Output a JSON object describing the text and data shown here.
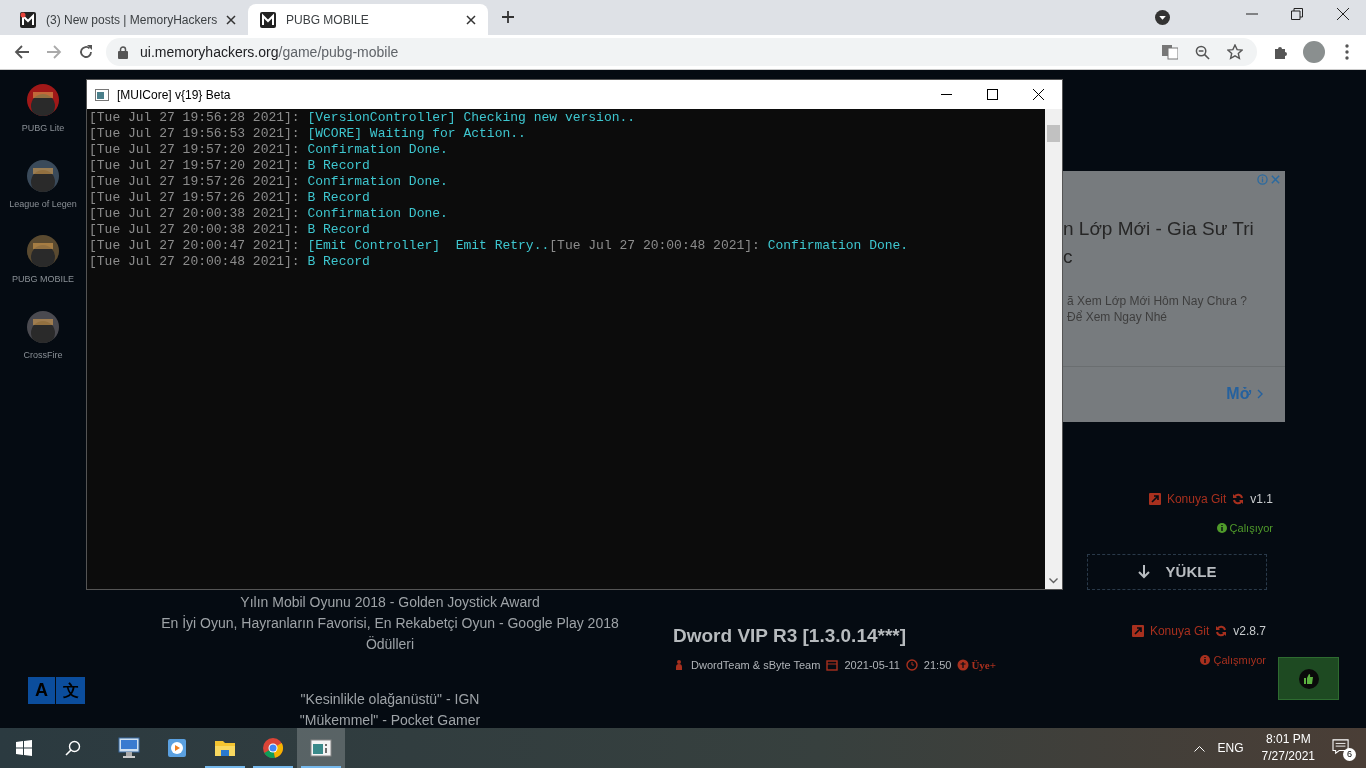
{
  "browser": {
    "tabs": [
      {
        "title": "(3) New posts | MemoryHackers",
        "selected": false,
        "notification": true
      },
      {
        "title": "PUBG MOBILE",
        "selected": true,
        "notification": false
      }
    ],
    "url": {
      "host": "ui.memoryhackers.org",
      "path": "/game/pubg-mobile"
    }
  },
  "sidebar": {
    "games": [
      {
        "label": "PUBG Lite"
      },
      {
        "label": "League of Legen"
      },
      {
        "label": "PUBG MOBILE"
      },
      {
        "label": "CrossFire"
      }
    ]
  },
  "ad": {
    "headline_lines": [
      "n Lớp Mới - Gia Sư Tri",
      "c"
    ],
    "body_lines": [
      "ã Xem Lớp Mới Hôm Nay Chưa ?",
      "Để Xem Ngay Nhé"
    ],
    "button": "Mở"
  },
  "products": [
    {
      "link": "Konuya Git",
      "version": "v1.1",
      "status": "Çalışıyor",
      "working": true,
      "download_button": "YÜKLE"
    },
    {
      "title": "Dword VIP R3 [1.3.0.14***]",
      "author": "DwordTeam & sByte Team",
      "date": "2021-05-11",
      "time": "21:50",
      "tag": "Üye+",
      "link": "Konuya Git",
      "version": "v2.8.7",
      "status": "Çalışmıyor",
      "working": false
    }
  ],
  "description": [
    "Yılın Mobil Oyunu 2018 - Golden Joystick Award",
    "En İyi Oyun, Hayranların Favorisi, En Rekabetçi Oyun - Google Play 2018 Ödülleri",
    "\"Kesinlikle olağanüstü\" - IGN",
    "\"Mükemmel\" - Pocket Gamer"
  ],
  "translate_button": {
    "left": "A",
    "right": "文"
  },
  "console": {
    "title": "[MUICore] v{19} Beta",
    "lines": [
      {
        "segments": [
          {
            "kind": "stamp",
            "text": "[Tue Jul 27 19:56:28 2021]: "
          },
          {
            "kind": "message",
            "text": "[VersionController] Checking new version.."
          }
        ]
      },
      {
        "segments": [
          {
            "kind": "stamp",
            "text": "[Tue Jul 27 19:56:53 2021]: "
          },
          {
            "kind": "message",
            "text": "[WCORE] Waiting for Action.."
          }
        ]
      },
      {
        "segments": [
          {
            "kind": "stamp",
            "text": "[Tue Jul 27 19:57:20 2021]: "
          },
          {
            "kind": "message",
            "text": "Confirmation Done."
          }
        ]
      },
      {
        "segments": [
          {
            "kind": "stamp",
            "text": "[Tue Jul 27 19:57:20 2021]: "
          },
          {
            "kind": "message",
            "text": "B Record"
          }
        ]
      },
      {
        "segments": [
          {
            "kind": "stamp",
            "text": "[Tue Jul 27 19:57:26 2021]: "
          },
          {
            "kind": "message",
            "text": "Confirmation Done."
          }
        ]
      },
      {
        "segments": [
          {
            "kind": "stamp",
            "text": "[Tue Jul 27 19:57:26 2021]: "
          },
          {
            "kind": "message",
            "text": "B Record"
          }
        ]
      },
      {
        "segments": [
          {
            "kind": "stamp",
            "text": "[Tue Jul 27 20:00:38 2021]: "
          },
          {
            "kind": "message",
            "text": "Confirmation Done."
          }
        ]
      },
      {
        "segments": [
          {
            "kind": "stamp",
            "text": "[Tue Jul 27 20:00:38 2021]: "
          },
          {
            "kind": "message",
            "text": "B Record"
          }
        ]
      },
      {
        "segments": [
          {
            "kind": "stamp",
            "text": "[Tue Jul 27 20:00:47 2021]: "
          },
          {
            "kind": "message",
            "text": "[Emit Controller]  Emit Retry.."
          },
          {
            "kind": "stamp",
            "text": "[Tue Jul 27 20:00:48 2021]: "
          },
          {
            "kind": "message",
            "text": "Confirmation Done."
          }
        ]
      },
      {
        "segments": [
          {
            "kind": "stamp",
            "text": "[Tue Jul 27 20:00:48 2021]: "
          },
          {
            "kind": "message",
            "text": "B Record"
          }
        ]
      }
    ]
  },
  "taskbar": {
    "apps": [
      {
        "kind": "monitor",
        "open": false,
        "selected": false
      },
      {
        "kind": "player",
        "open": false,
        "selected": false
      },
      {
        "kind": "folder",
        "open": true,
        "selected": false
      },
      {
        "kind": "browser",
        "open": true,
        "selected": false
      },
      {
        "kind": "console",
        "open": true,
        "selected": true
      }
    ],
    "language": "ENG",
    "time": "8:01 PM",
    "date": "7/27/2021",
    "notifications": "6"
  }
}
